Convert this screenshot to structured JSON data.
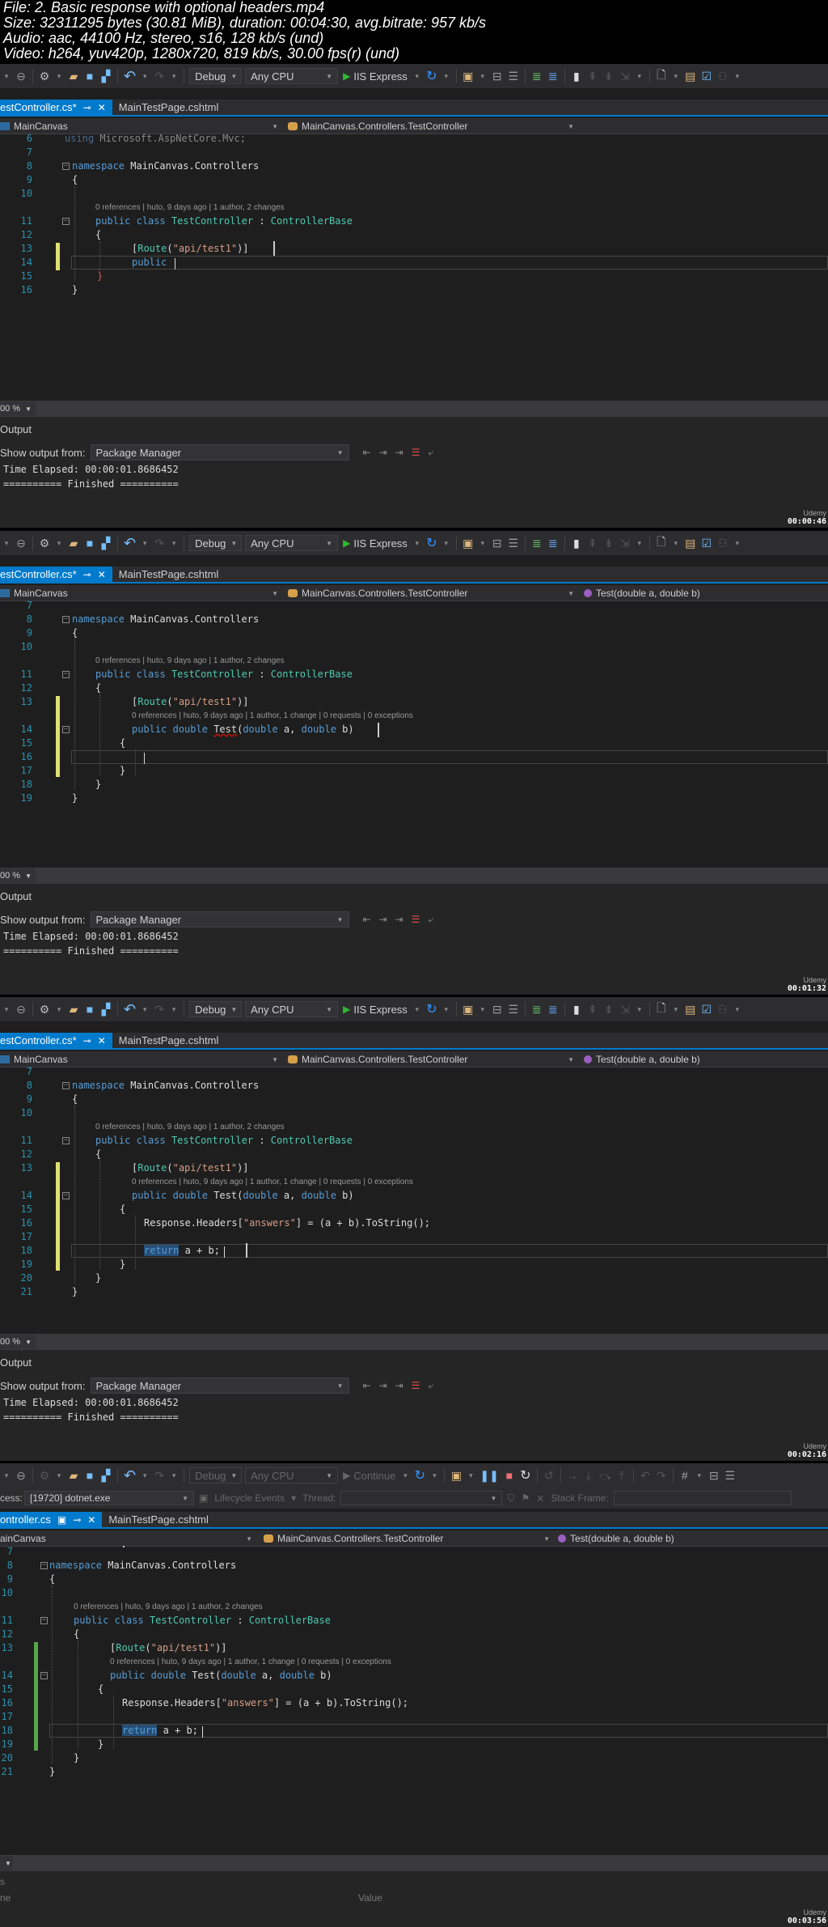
{
  "meta": {
    "file": "File: 2. Basic response with optional headers.mp4",
    "size": "Size: 32311295 bytes (30.81 MiB), duration: 00:04:30, avg.bitrate: 957 kb/s",
    "audio": "Audio: aac, 44100 Hz, stereo, s16, 128 kb/s (und)",
    "video": "Video: h264, yuv420p, 1280x720, 819 kb/s, 30.00 fps(r) (und)"
  },
  "toolbar": {
    "config": "Debug",
    "platform": "Any CPU",
    "run_label": "IIS Express",
    "continue_label": "Continue"
  },
  "debug_location": {
    "process_label": "cess:",
    "process_value": "[19720] dotnet.exe",
    "lifecycle_label": "Lifecycle Events",
    "thread_label": "Thread:",
    "stack_frame_label": "Stack Frame:"
  },
  "tabs": {
    "active_modified": "estController.cs*",
    "active_debug": "ontroller.cs",
    "inactive": "MainTestPage.cshtml"
  },
  "navbar": {
    "project": "MainCanvas",
    "project_cut": "ainCanvas",
    "class": "MainCanvas.Controllers.TestController",
    "member": "Test(double a, double b)"
  },
  "code": {
    "using_line": "using Microsoft.AspNetCore.Mvc;",
    "namespace_kw": "namespace",
    "namespace_name": " MainCanvas.Controllers",
    "lens_class": "0 references | huto, 9 days ago | 1 author, 2 changes",
    "lens_method": "0 references | huto, 9 days ago | 1 author, 1 change | 0 requests | 0 exceptions",
    "public": "public",
    "class": "class",
    "class_name": "TestController",
    "colon": " : ",
    "base": "ControllerBase",
    "route_open": "[",
    "route": "Route",
    "route_paren_open": "(",
    "route_str": "\"api/test1\"",
    "route_close": ")]",
    "double": "double",
    "method_name": "Test",
    "param_a": " a, ",
    "param_b": " b)",
    "paren": "(",
    "response_pre": "Response.Headers[",
    "response_str": "\"answers\"",
    "response_post": "] = (a + b).ToString();",
    "return_kw": "return",
    "return_rest": " a + b;",
    "open_brace": "{",
    "close_brace": "}"
  },
  "frames": [
    {
      "line_numbers": [
        "6",
        "7",
        "8",
        "9",
        "10",
        "11",
        "12",
        "13",
        "14",
        "15",
        "16"
      ],
      "timestamp": "00:00:46"
    },
    {
      "line_numbers": [
        "7",
        "8",
        "9",
        "10",
        "11",
        "12",
        "13",
        "14",
        "15",
        "16",
        "17",
        "18",
        "19"
      ],
      "timestamp": "00:01:32"
    },
    {
      "line_numbers": [
        "7",
        "8",
        "9",
        "10",
        "11",
        "12",
        "13",
        "14",
        "15",
        "16",
        "17",
        "18",
        "19",
        "20",
        "21"
      ],
      "timestamp": "00:02:16"
    },
    {
      "line_numbers": [
        "7",
        "8",
        "9",
        "10",
        "11",
        "12",
        "13",
        "14",
        "15",
        "16",
        "17",
        "18",
        "19",
        "20",
        "21"
      ],
      "timestamp": "00:03:56"
    }
  ],
  "zoom": "00 %",
  "output": {
    "title": "Output",
    "show_from_label": "Show output from:",
    "source": "Package Manager",
    "line1": "Time Elapsed: 00:00:01.8686452",
    "line2": "========== Finished =========="
  },
  "locals": {
    "title": "s",
    "col_name": "ne",
    "col_value": "Value"
  },
  "watermark": "Udemy"
}
